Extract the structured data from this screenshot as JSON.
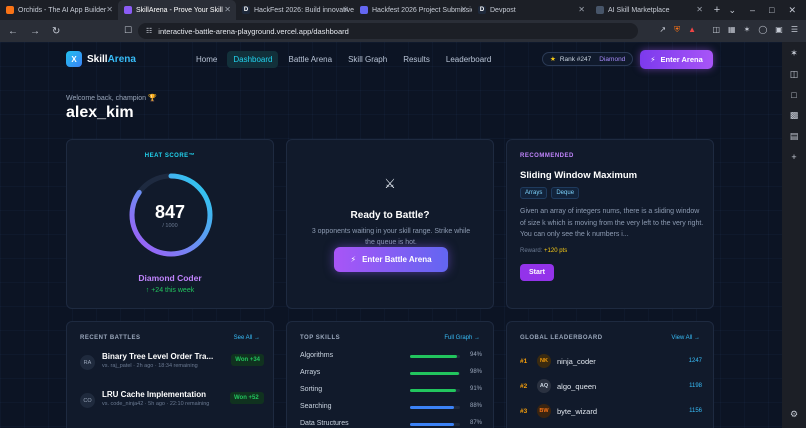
{
  "browser": {
    "tabs": [
      {
        "title": "Orchids - The AI App Builder",
        "color": "#f97316",
        "glyph": ""
      },
      {
        "title": "SkillArena - Prove Your Skill",
        "color": "#8b5cf6",
        "glyph": ""
      },
      {
        "title": "HackFest 2026: Build innovative",
        "color": "#1e293b",
        "glyph": "D"
      },
      {
        "title": "Hackfest 2026 Project Submissio",
        "color": "#6366f1",
        "glyph": ""
      },
      {
        "title": "Devpost",
        "color": "#1e293b",
        "glyph": "D"
      },
      {
        "title": "AI Skill Marketplace",
        "color": "#475569",
        "glyph": ""
      }
    ],
    "url": "interactive-battle-arena-playground.vercel.app/dashboard"
  },
  "nav": {
    "brand_a": "Skill",
    "brand_b": "Arena",
    "brand_mark": "X",
    "links": [
      "Home",
      "Dashboard",
      "Battle Arena",
      "Skill Graph",
      "Results",
      "Leaderboard"
    ],
    "active": "Dashboard",
    "rank": "Rank #247",
    "tier": "Diamond",
    "enter": "Enter Arena"
  },
  "welcome": "Welcome back, champion 🏆",
  "username": "alex_kim",
  "heat": {
    "label": "HEAT SCORE™",
    "score": "847",
    "max": "/ 1000",
    "progress": 0.847,
    "tier": "Diamond Coder",
    "delta": "↑ +24 this week"
  },
  "battle": {
    "title": "Ready to Battle?",
    "desc": "3 opponents waiting in your skill range. Strike while the queue is hot.",
    "cta": "Enter Battle Arena"
  },
  "recommended": {
    "label": "RECOMMENDED",
    "title": "Sliding Window Maximum",
    "tags": [
      "Arrays",
      "Deque"
    ],
    "desc": "Given an array of integers nums, there is a sliding window of size k which is moving from the very left to the very right. You can only see the k numbers i...",
    "reward_label": "Reward:",
    "reward": "+120 pts",
    "start": "Start"
  },
  "recent": {
    "label": "RECENT BATTLES",
    "link": "See All →",
    "items": [
      {
        "initials": "RA",
        "title": "Binary Tree Level Order Tra...",
        "meta": "vs. raj_patel · 2h ago · 18:34 remaining",
        "result": "Won +34"
      },
      {
        "initials": "CO",
        "title": "LRU Cache Implementation",
        "meta": "vs. code_ninja42 · 5h ago · 22:10 remaining",
        "result": "Won +52"
      }
    ]
  },
  "skills": {
    "label": "TOP SKILLS",
    "link": "Full Graph →",
    "items": [
      {
        "name": "Algorithms",
        "pct": "94%",
        "value": 0.94,
        "color": "#22c55e"
      },
      {
        "name": "Arrays",
        "pct": "98%",
        "value": 0.98,
        "color": "#22c55e"
      },
      {
        "name": "Sorting",
        "pct": "91%",
        "value": 0.91,
        "color": "#22c55e"
      },
      {
        "name": "Searching",
        "pct": "88%",
        "value": 0.88,
        "color": "#3b82f6"
      },
      {
        "name": "Data Structures",
        "pct": "87%",
        "value": 0.87,
        "color": "#3b82f6"
      }
    ]
  },
  "global": {
    "label": "GLOBAL LEADERBOARD",
    "link": "View All →",
    "items": [
      {
        "pos": "#1",
        "initials": "NK",
        "name": "ninja_coder",
        "score": "1247",
        "bg": "#3a2a10",
        "fg": "#f59e0b"
      },
      {
        "pos": "#2",
        "initials": "AQ",
        "name": "algo_queen",
        "score": "1198",
        "bg": "#2a3140",
        "fg": "#cbd5e1"
      },
      {
        "pos": "#3",
        "initials": "BW",
        "name": "byte_wizard",
        "score": "1156",
        "bg": "#3a2410",
        "fg": "#f97316"
      }
    ]
  }
}
